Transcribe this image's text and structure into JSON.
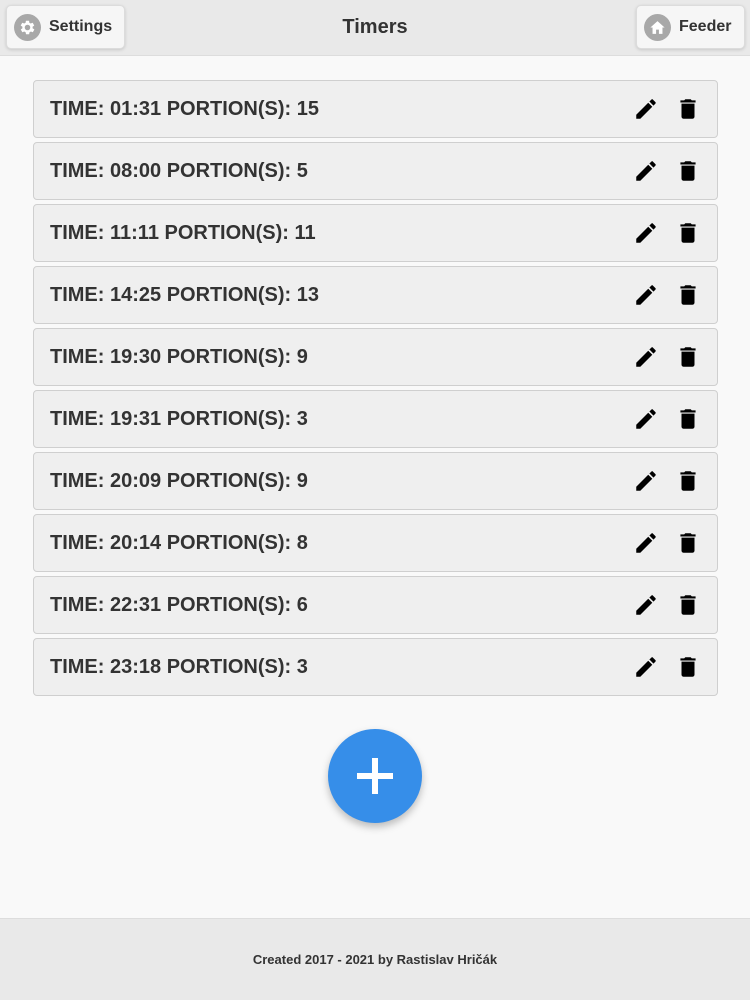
{
  "header": {
    "title": "Timers",
    "settings_label": "Settings",
    "feeder_label": "Feeder"
  },
  "timers": [
    {
      "label": "TIME: 01:31 PORTION(S): 15"
    },
    {
      "label": "TIME: 08:00 PORTION(S): 5"
    },
    {
      "label": "TIME: 11:11 PORTION(S): 11"
    },
    {
      "label": "TIME: 14:25 PORTION(S): 13"
    },
    {
      "label": "TIME: 19:30 PORTION(S): 9"
    },
    {
      "label": "TIME: 19:31 PORTION(S): 3"
    },
    {
      "label": "TIME: 20:09 PORTION(S): 9"
    },
    {
      "label": "TIME: 20:14 PORTION(S): 8"
    },
    {
      "label": "TIME: 22:31 PORTION(S): 6"
    },
    {
      "label": "TIME: 23:18 PORTION(S): 3"
    }
  ],
  "icons": {
    "settings": "gear-icon",
    "feeder": "home-icon",
    "edit": "pencil-icon",
    "delete": "trash-icon",
    "add": "plus-icon"
  },
  "colors": {
    "accent": "#368ee9",
    "header_bg": "#e9e9e9",
    "row_bg": "#efefef"
  },
  "footer": {
    "text": "Created 2017 - 2021 by Rastislav Hričák"
  }
}
